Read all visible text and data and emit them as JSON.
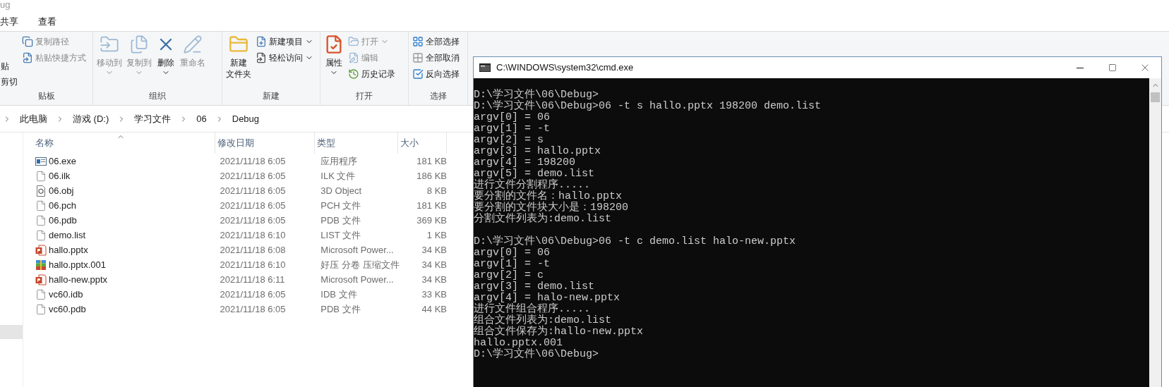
{
  "explorer": {
    "title": "ug",
    "tabs": [
      {
        "label": "共享",
        "selected": false
      },
      {
        "label": "查看",
        "selected": false
      }
    ],
    "ribbon": [
      {
        "label": "贴板",
        "items": [
          {
            "label": "贴",
            "kind": "fragment",
            "disabled": false
          },
          {
            "label": "剪切",
            "kind": "fragment",
            "disabled": false
          },
          {
            "label": "复制路径",
            "kind": "small",
            "disabled": true,
            "dropdown": false
          },
          {
            "label": "粘贴快捷方式",
            "kind": "small",
            "disabled": true,
            "dropdown": false
          }
        ]
      },
      {
        "label": "组织",
        "items": [
          {
            "lines": [
              "移动到"
            ],
            "kind": "large",
            "disabled": true,
            "dropdown": true
          },
          {
            "lines": [
              "复制到"
            ],
            "kind": "large",
            "disabled": true,
            "dropdown": true
          },
          {
            "lines": [
              "删除"
            ],
            "kind": "large",
            "disabled": false,
            "dropdown": true
          },
          {
            "lines": [
              "重命名"
            ],
            "kind": "large",
            "disabled": true,
            "dropdown": false
          }
        ]
      },
      {
        "label": "新建",
        "items": [
          {
            "lines": [
              "新建",
              "文件夹"
            ],
            "kind": "large",
            "disabled": false,
            "dropdown": false
          },
          {
            "label": "新建项目",
            "kind": "small",
            "disabled": false,
            "dropdown": true
          },
          {
            "label": "轻松访问",
            "kind": "small",
            "disabled": false,
            "dropdown": true
          }
        ]
      },
      {
        "label": "打开",
        "items": [
          {
            "lines": [
              "属性"
            ],
            "kind": "large",
            "disabled": false,
            "dropdown": true
          },
          {
            "label": "打开",
            "kind": "small",
            "disabled": true,
            "dropdown": true
          },
          {
            "label": "编辑",
            "kind": "small",
            "disabled": true,
            "dropdown": false
          },
          {
            "label": "历史记录",
            "kind": "small",
            "disabled": false,
            "dropdown": false
          }
        ]
      },
      {
        "label": "选择",
        "items": [
          {
            "label": "全部选择",
            "kind": "small",
            "disabled": false,
            "dropdown": false
          },
          {
            "label": "全部取消",
            "kind": "small",
            "disabled": false,
            "dropdown": false
          },
          {
            "label": "反向选择",
            "kind": "small",
            "disabled": false,
            "dropdown": false
          }
        ]
      }
    ],
    "breadcrumb": [
      "此电脑",
      "游戏 (D:)",
      "学习文件",
      "06",
      "Debug"
    ],
    "columns": [
      "名称",
      "修改日期",
      "类型",
      "大小"
    ],
    "files": [
      {
        "name": "06.exe",
        "date": "2021/11/18 6:05",
        "type": "应用程序",
        "size": "181 KB",
        "kind": "exe"
      },
      {
        "name": "06.ilk",
        "date": "2021/11/18 6:05",
        "type": "ILK 文件",
        "size": "186 KB",
        "kind": "file"
      },
      {
        "name": "06.obj",
        "date": "2021/11/18 6:05",
        "type": "3D Object",
        "size": "8 KB",
        "kind": "object"
      },
      {
        "name": "06.pch",
        "date": "2021/11/18 6:05",
        "type": "PCH 文件",
        "size": "181 KB",
        "kind": "file"
      },
      {
        "name": "06.pdb",
        "date": "2021/11/18 6:05",
        "type": "PDB 文件",
        "size": "369 KB",
        "kind": "file"
      },
      {
        "name": "demo.list",
        "date": "2021/11/18 6:10",
        "type": "LIST 文件",
        "size": "1 KB",
        "kind": "file"
      },
      {
        "name": "hallo.pptx",
        "date": "2021/11/18 6:08",
        "type": "Microsoft Power...",
        "size": "34 KB",
        "kind": "pptx"
      },
      {
        "name": "hallo.pptx.001",
        "date": "2021/11/18 6:10",
        "type": "好压 分卷 压缩文件",
        "size": "34 KB",
        "kind": "archive"
      },
      {
        "name": "hallo-new.pptx",
        "date": "2021/11/18 6:11",
        "type": "Microsoft Power...",
        "size": "34 KB",
        "kind": "pptx"
      },
      {
        "name": "vc60.idb",
        "date": "2021/11/18 6:05",
        "type": "IDB 文件",
        "size": "33 KB",
        "kind": "file"
      },
      {
        "name": "vc60.pdb",
        "date": "2021/11/18 6:05",
        "type": "PDB 文件",
        "size": "44 KB",
        "kind": "file"
      }
    ]
  },
  "console": {
    "title": "C:\\WINDOWS\\system32\\cmd.exe",
    "blocks": [
      [
        "D:\\学习文件\\06\\Debug>",
        "D:\\学习文件\\06\\Debug>06 -t s hallo.pptx 198200 demo.list",
        "argv[0] = 06",
        "argv[1] = -t",
        "argv[2] = s",
        "argv[3] = hallo.pptx",
        "argv[4] = 198200",
        "argv[5] = demo.list",
        "进行文件分割程序.....",
        "要分割的文件名：hallo.pptx",
        "要分割的文件块大小是：198200",
        "分割文件列表为:demo.list"
      ],
      [
        "D:\\学习文件\\06\\Debug>06 -t c demo.list halo-new.pptx",
        "argv[0] = 06",
        "argv[1] = -t",
        "argv[2] = c",
        "argv[3] = demo.list",
        "argv[4] = halo-new.pptx",
        "进行文件组合程序.....",
        "组合文件列表为:demo.list",
        "组合文件保存为:hallo-new.pptx",
        "hallo.pptx.001",
        "D:\\学习文件\\06\\Debug>"
      ]
    ]
  }
}
